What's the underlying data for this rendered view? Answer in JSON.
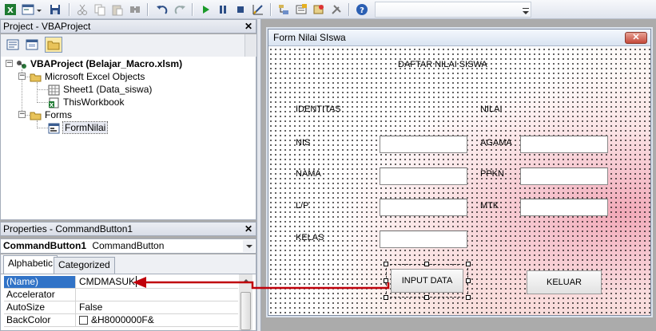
{
  "project_pane": {
    "title": "Project - VBAProject",
    "tree": {
      "root": "VBAProject (Belajar_Macro.xlsm)",
      "excel_objects_folder": "Microsoft Excel Objects",
      "sheet1": "Sheet1 (Data_siswa)",
      "this_workbook": "ThisWorkbook",
      "forms_folder": "Forms",
      "form_nilai": "FormNilai"
    }
  },
  "properties_pane": {
    "title": "Properties - CommandButton1",
    "object_name": "CommandButton1",
    "object_type": "CommandButton",
    "tabs": {
      "alphabetic": "Alphabetic",
      "categorized": "Categorized"
    },
    "rows": [
      {
        "key": "(Name)",
        "value": "CMDMASUK"
      },
      {
        "key": "Accelerator",
        "value": ""
      },
      {
        "key": "AutoSize",
        "value": "False"
      },
      {
        "key": "BackColor",
        "value": "&H8000000F&"
      }
    ]
  },
  "form": {
    "title": "Form Nilai SIswa",
    "close_label": "✕",
    "heading": "DAFTAR NILAI SISWA",
    "identitas": "IDENTITAS",
    "nilai": "NILAI",
    "nis": "NIS",
    "nama": "NAMA",
    "lp": "L/P",
    "kelas": "KELAS",
    "agama": "AGAMA",
    "ppkn": "PPKN",
    "mtk": "MTK",
    "input_button": "INPUT DATA",
    "keluar_button": "KELUAR"
  },
  "colors": {
    "selection_blue": "#3173c7",
    "annotation_arrow": "#c0000a"
  }
}
